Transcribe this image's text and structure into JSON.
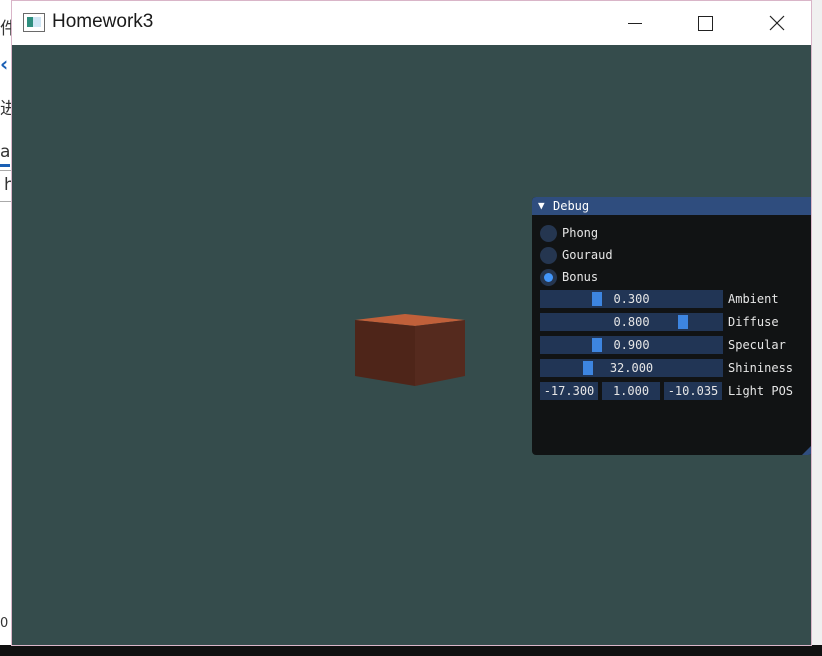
{
  "background_app": {
    "fragments": [
      "件",
      "进",
      "a",
      "h",
      "0"
    ]
  },
  "window": {
    "title": "Homework3",
    "controls": {
      "minimize": "minimize",
      "maximize": "maximize",
      "close": "close"
    }
  },
  "viewport": {
    "background_color": "#354c4c",
    "cube_color": "#5a2a1f"
  },
  "debug_panel": {
    "title": "Debug",
    "collapse_arrow": "▼",
    "shading_modes": [
      {
        "label": "Phong",
        "selected": false
      },
      {
        "label": "Gouraud",
        "selected": false
      },
      {
        "label": "Bonus",
        "selected": true
      }
    ],
    "sliders": [
      {
        "label": "Ambient",
        "value": "0.300",
        "fraction": 0.3
      },
      {
        "label": "Diffuse",
        "value": "0.800",
        "fraction": 0.8
      },
      {
        "label": "Specular",
        "value": "0.900",
        "fraction": 0.3
      },
      {
        "label": "Shininess",
        "value": "32.000",
        "fraction": 0.25
      }
    ],
    "light_pos": {
      "label": "Light POS",
      "x": "-17.300",
      "y": "1.000",
      "z": "-10.035"
    },
    "accent_color": "#4296fa",
    "header_color": "#2f4d7e"
  }
}
